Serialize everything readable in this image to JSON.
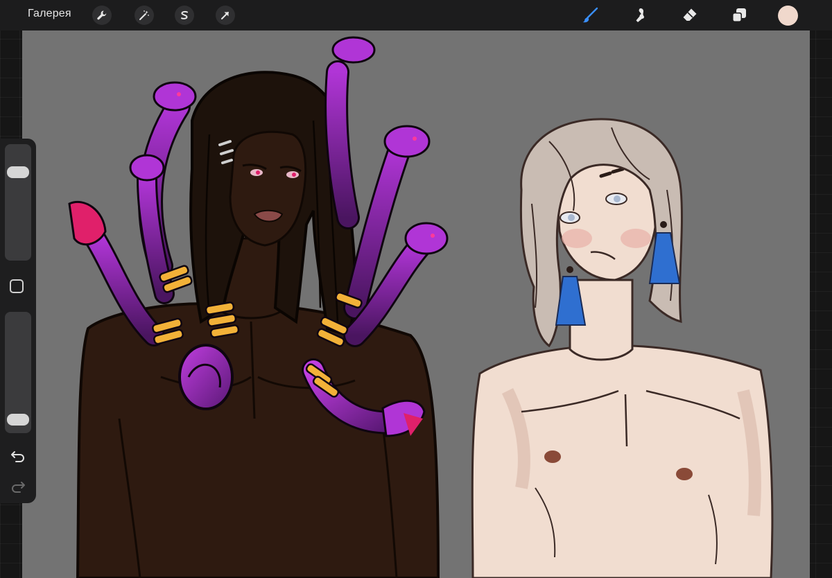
{
  "app": {
    "gallery_label": "Галерея"
  },
  "toolbar_left": [
    {
      "name": "actions-wrench-icon"
    },
    {
      "name": "adjustments-magic-wand-icon"
    },
    {
      "name": "selection-s-icon"
    },
    {
      "name": "transform-arrow-icon"
    }
  ],
  "toolbar_right": [
    {
      "name": "brush-icon",
      "active": true
    },
    {
      "name": "smudge-icon"
    },
    {
      "name": "eraser-icon"
    },
    {
      "name": "layers-icon"
    }
  ],
  "colors": {
    "current_color": "#f0d8cc",
    "active_tool": "#3a8fff",
    "canvas_bg": "#737373"
  },
  "sidebar": {
    "brush_size_level": 0.8,
    "opacity_level": 0.05
  }
}
